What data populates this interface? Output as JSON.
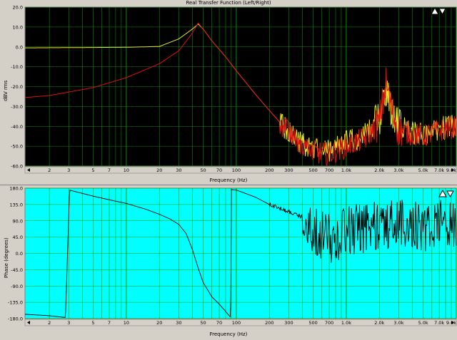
{
  "icons": {
    "top": "zoom-arrows-icon",
    "bottom": "zoom-arrows-icon"
  },
  "colors": {
    "top_bg": "#000000",
    "top_grid": "#0c8a0c",
    "bottom_bg": "#00ffff",
    "bottom_grid": "#00a000",
    "left_trace": "#e8e830",
    "right_trace": "#e01010",
    "phase_trace": "#000000"
  },
  "chart_data": [
    {
      "type": "line",
      "title": "Real Transfer Function (Left/Right)",
      "xlabel": "Frequency (Hz)",
      "ylabel": "dBV rms",
      "xscale": "log",
      "xlim": [
        1.2,
        10000
      ],
      "ylim": [
        -60,
        20
      ],
      "grid": true,
      "ytick_labels": [
        "20.0",
        "10.0",
        "0.0",
        "-10.0",
        "-20.0",
        "-30.0",
        "-40.0",
        "-50.0",
        "-60.0"
      ],
      "ytick_values": [
        20,
        10,
        0,
        -10,
        -20,
        -30,
        -40,
        -50,
        -60
      ],
      "xtick_labels": [
        "2",
        "3",
        "5",
        "7",
        "10",
        "20",
        "30",
        "50",
        "70",
        "100",
        "200",
        "300",
        "500",
        "700",
        "1.0k",
        "2.0k",
        "3.0k",
        "5.0k",
        "7.0k",
        "9.0k"
      ],
      "xtick_values": [
        2,
        3,
        5,
        7,
        10,
        20,
        30,
        50,
        70,
        100,
        200,
        300,
        500,
        700,
        1000,
        2000,
        3000,
        5000,
        7000,
        9000
      ],
      "series": [
        {
          "color": "#e8e830",
          "x": [
            1.2,
            5,
            10,
            20,
            30,
            40,
            45,
            50,
            60,
            80,
            100,
            150,
            200,
            250,
            300,
            400,
            500,
            700,
            1000,
            1500,
            2000,
            2300,
            2600,
            3000,
            4000,
            5000,
            7000,
            10000
          ],
          "y": [
            -0.5,
            -0.3,
            -0.2,
            0.2,
            4,
            9,
            11.5,
            9,
            3,
            -5,
            -12,
            -24,
            -32,
            -38,
            -43,
            -49,
            -51,
            -52,
            -48,
            -44,
            -36,
            -23,
            -32,
            -40,
            -43,
            -44,
            -41,
            -40
          ]
        },
        {
          "color": "#e01010",
          "x": [
            1.2,
            2,
            5,
            10,
            20,
            30,
            40,
            45,
            50,
            60,
            80,
            100,
            150,
            200,
            250,
            300,
            400,
            500,
            700,
            1000,
            1500,
            2000,
            2300,
            2600,
            3000,
            4000,
            5000,
            7000,
            10000
          ],
          "y": [
            -25.5,
            -24.5,
            -20.5,
            -15.5,
            -8.5,
            -2,
            7,
            12,
            9,
            3,
            -5,
            -12,
            -24,
            -32,
            -38,
            -43,
            -49,
            -53,
            -54,
            -50,
            -46,
            -38,
            -18,
            -32,
            -42,
            -44,
            -45,
            -42,
            -40
          ]
        }
      ]
    },
    {
      "type": "line",
      "xlabel": "Frequency (Hz)",
      "ylabel": "Phase (degrees)",
      "xscale": "log",
      "xlim": [
        1.2,
        10000
      ],
      "ylim": [
        -180,
        180
      ],
      "grid": true,
      "ytick_labels": [
        "180.0",
        "135.0",
        "90.0",
        "45.0",
        "0.0",
        "-45.0",
        "-90.0",
        "-135.0",
        "-180.0"
      ],
      "ytick_values": [
        180,
        135,
        90,
        45,
        0,
        -45,
        -90,
        -135,
        -180
      ],
      "xtick_labels": [
        "2",
        "3",
        "5",
        "7",
        "10",
        "20",
        "30",
        "50",
        "70",
        "100",
        "200",
        "300",
        "500",
        "700",
        "1.0k",
        "2.0k",
        "3.0k",
        "5.0k",
        "7.0k",
        "9.0k"
      ],
      "xtick_values": [
        2,
        3,
        5,
        7,
        10,
        20,
        30,
        50,
        70,
        100,
        200,
        300,
        500,
        700,
        1000,
        2000,
        3000,
        5000,
        7000,
        9000
      ],
      "series": [
        {
          "color": "#000000",
          "x": [
            1.2,
            2,
            2.8,
            3.05,
            3.3,
            5,
            7,
            10,
            15,
            20,
            25,
            30,
            35,
            40,
            45,
            50,
            60,
            70,
            80,
            89,
            90,
            91,
            100,
            150,
            200,
            300,
            400,
            500,
            700,
            1000,
            2000,
            3000,
            5000,
            7000,
            10000
          ],
          "y": [
            -168,
            -172,
            -177,
            175,
            172,
            158,
            148,
            138,
            122,
            108,
            95,
            80,
            55,
            10,
            -40,
            -80,
            -120,
            -140,
            -160,
            -177,
            178,
            176,
            175,
            155,
            135,
            115,
            100,
            70,
            40,
            60,
            80,
            85,
            75,
            80,
            75
          ]
        }
      ]
    }
  ]
}
